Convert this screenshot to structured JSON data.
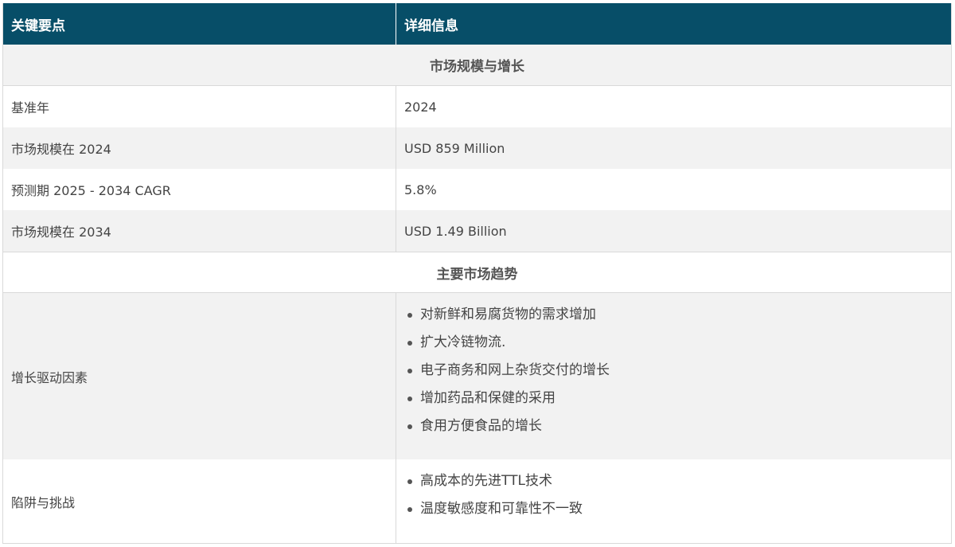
{
  "header": {
    "col1": "关键要点",
    "col2": "详细信息"
  },
  "sections": {
    "market": "市场规模与增长",
    "trends": "主要市场趋势"
  },
  "rows": [
    {
      "label": "基准年",
      "value": "2024"
    },
    {
      "label": "市场规模在 2024",
      "value": "USD 859 Million"
    },
    {
      "label": "预测期 2025 - 2034 CAGR",
      "value": "5.8%"
    },
    {
      "label": "市场规模在 2034",
      "value": "USD 1.49 Billion"
    }
  ],
  "drivers": {
    "label": "增长驱动因素",
    "items": [
      "对新鲜和易腐货物的需求增加",
      "扩大冷链物流.",
      "电子商务和网上杂货交付的增长",
      "增加药品和保健的采用",
      "食用方便食品的增长"
    ]
  },
  "pitfalls": {
    "label": "陷阱与挑战",
    "items": [
      "高成本的先进TTL技术",
      "温度敏感度和可靠性不一致"
    ]
  }
}
